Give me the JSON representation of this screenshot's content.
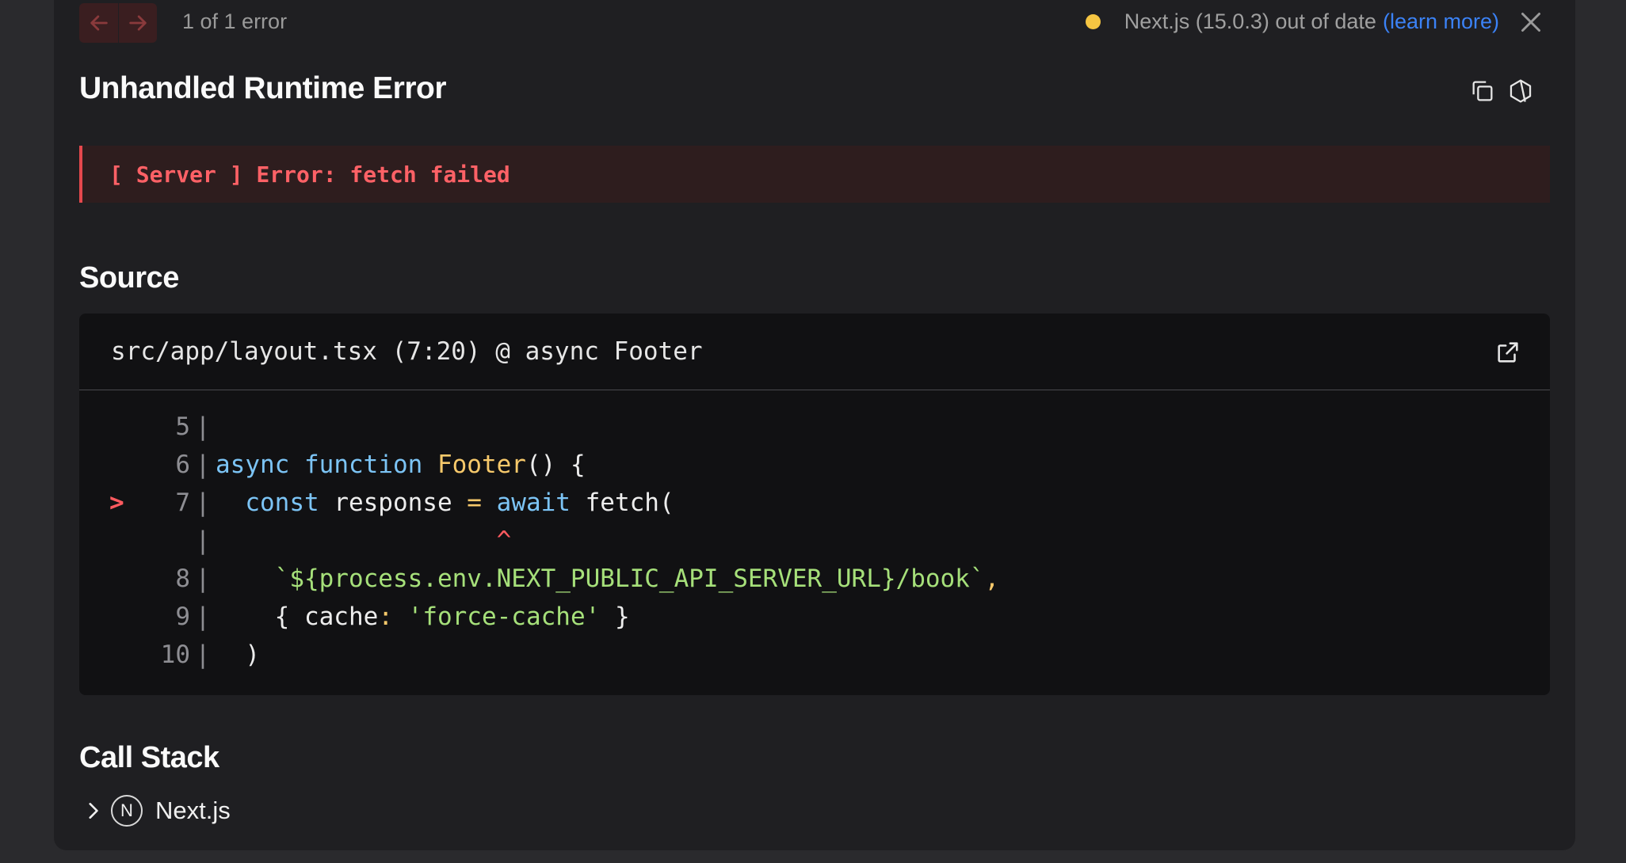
{
  "nav": {
    "prev_icon": "arrow-left-icon",
    "next_icon": "arrow-right-icon",
    "error_count": "1 of 1 error"
  },
  "version": {
    "status_color": "#f5c542",
    "text": "Next.js (15.0.3) out of date",
    "learn_more": "(learn more)"
  },
  "header": {
    "title": "Unhandled Runtime Error",
    "copy_icon": "copy-icon",
    "docs_icon": "hexagon-icon"
  },
  "error": {
    "message": "[ Server ] Error: fetch failed"
  },
  "source": {
    "heading": "Source",
    "location": "src/app/layout.tsx (7:20) @ async Footer",
    "open_icon": "external-link-icon",
    "lines": [
      {
        "num": "5",
        "marker": "",
        "code": ""
      },
      {
        "num": "6",
        "marker": "",
        "code": "async function Footer() {"
      },
      {
        "num": "7",
        "marker": ">",
        "code": "  const response = await fetch("
      },
      {
        "num": "",
        "marker": "",
        "code": "                   ^"
      },
      {
        "num": "8",
        "marker": "",
        "code": "    `${process.env.NEXT_PUBLIC_API_SERVER_URL}/book`,"
      },
      {
        "num": "9",
        "marker": "",
        "code": "    { cache: 'force-cache' }"
      },
      {
        "num": "10",
        "marker": "",
        "code": "  )"
      }
    ]
  },
  "call_stack": {
    "heading": "Call Stack",
    "group_label": "Next.js",
    "group_logo": "N"
  },
  "colors": {
    "accent_error": "#e5484d",
    "link": "#3b82f6"
  }
}
